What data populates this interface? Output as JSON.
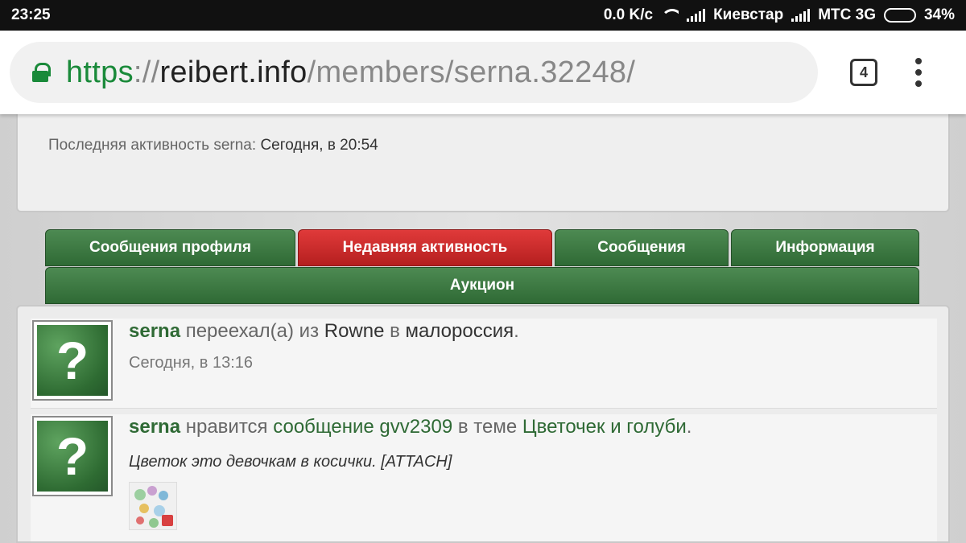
{
  "status_bar": {
    "time": "23:25",
    "speed": "0.0 K/c",
    "carrier1": "Киевстар",
    "carrier2": "МТС 3G",
    "battery": "34%",
    "battery_level": 0.34
  },
  "browser": {
    "url_scheme": "https",
    "url_sep": "://",
    "url_host": "reibert.info",
    "url_path": "/members/serna.32248/",
    "tab_count": "4"
  },
  "profile": {
    "last_activity_label": "Последняя активность serna:",
    "last_activity_value": "Сегодня, в 20:54"
  },
  "tabs": [
    {
      "label": "Сообщения профиля",
      "active": false
    },
    {
      "label": "Недавняя активность",
      "active": true
    },
    {
      "label": "Сообщения",
      "active": false
    },
    {
      "label": "Информация",
      "active": false
    }
  ],
  "tab_extra": {
    "label": "Аукцион"
  },
  "feed": [
    {
      "user": "serna",
      "t1": " переехал(а) из ",
      "place_from": "Rowne",
      "t2": " в ",
      "place_to": "малороссия",
      "t3": ".",
      "time": "Сегодня, в 13:16"
    },
    {
      "user": "serna",
      "t1": " нравится ",
      "link1": "сообщение gvv2309",
      "t2": " в теме ",
      "link2": "Цветочек и голуби",
      "t3": ".",
      "quote": "Цветок это девочкам в косички. [ATTACH]"
    }
  ],
  "colors": {
    "green": "#2f6a35",
    "red": "#c62828"
  },
  "icons": {
    "avatar": "question-mark-avatar",
    "lock": "lock-icon",
    "menu": "more-vert-icon"
  }
}
